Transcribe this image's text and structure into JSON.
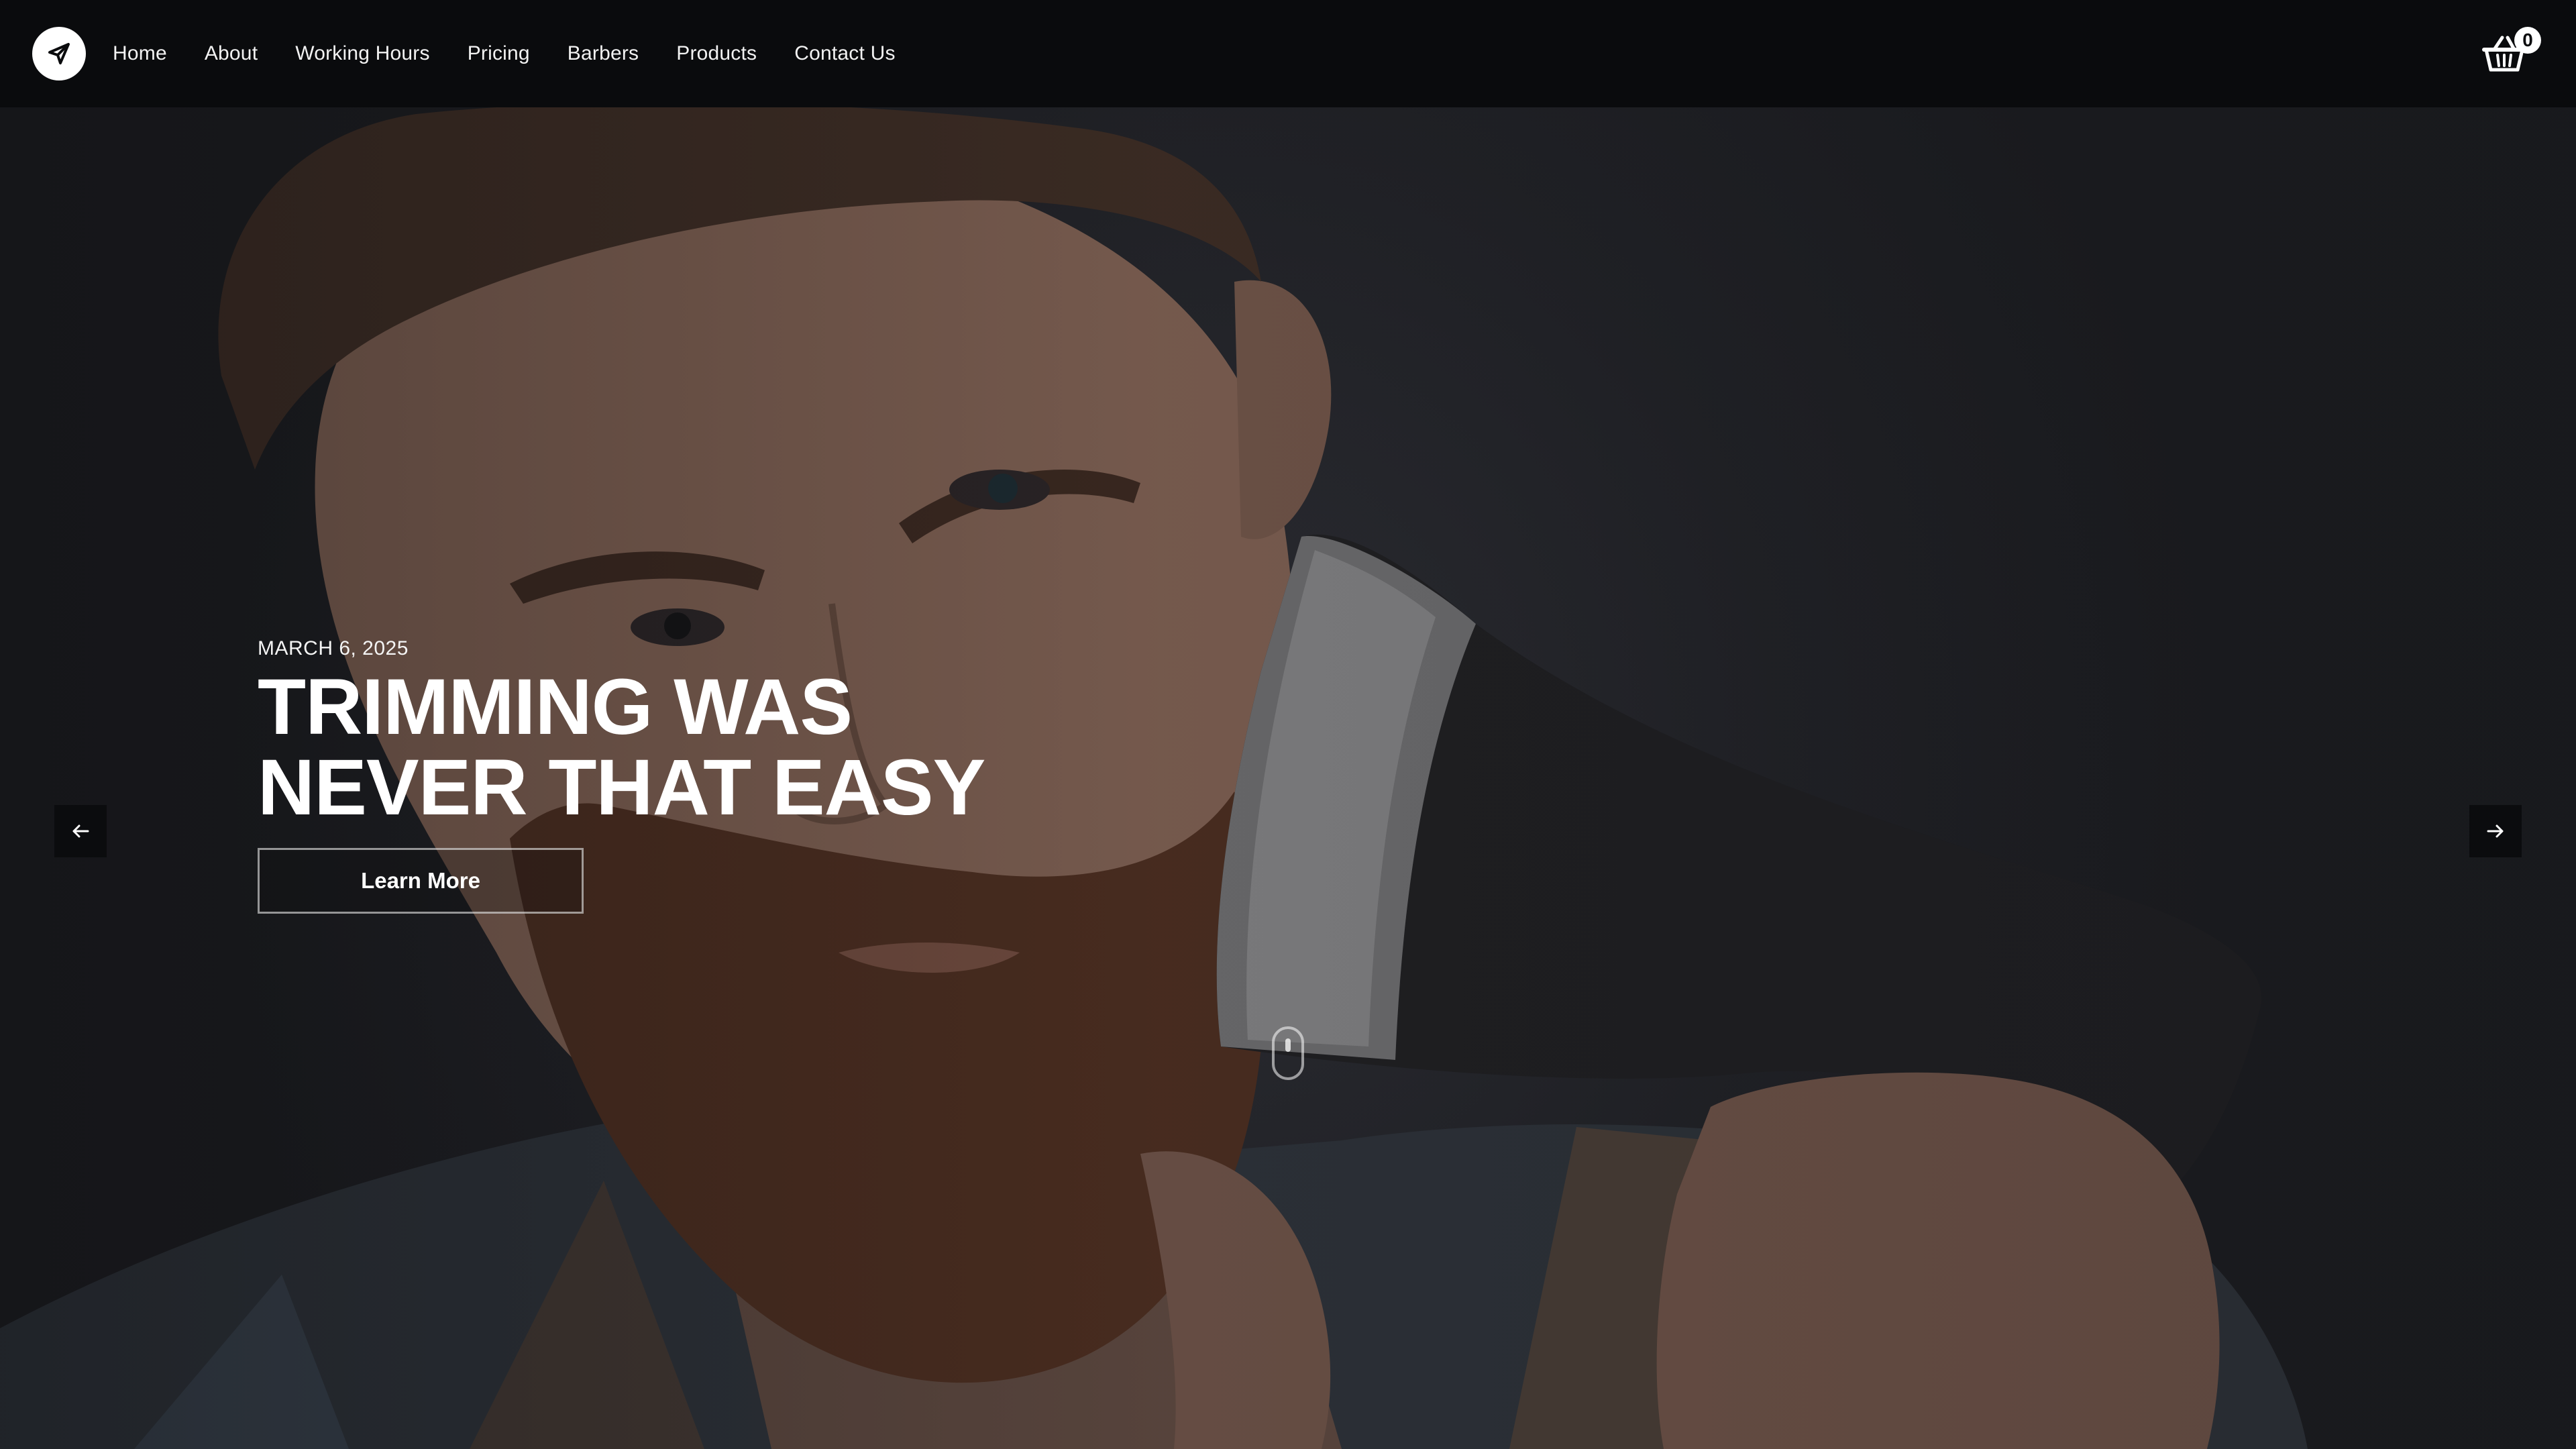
{
  "nav": {
    "items": [
      {
        "label": "Home"
      },
      {
        "label": "About"
      },
      {
        "label": "Working Hours"
      },
      {
        "label": "Pricing"
      },
      {
        "label": "Barbers"
      },
      {
        "label": "Products"
      },
      {
        "label": "Contact Us"
      }
    ],
    "cart_count": "0"
  },
  "hero": {
    "date": "MARCH 6, 2025",
    "title_line1": "TRIMMING WAS",
    "title_line2": "NEVER THAT EASY",
    "cta_label": "Learn More"
  },
  "icons": {
    "logo": "paper-plane-icon",
    "cart": "basket-icon",
    "prev": "arrow-left-icon",
    "next": "arrow-right-icon",
    "scroll": "mouse-scroll-icon"
  },
  "colors": {
    "navbar_bg": "#0a0b0d",
    "hero_bg": "#1b1c20",
    "text": "#ffffff"
  }
}
